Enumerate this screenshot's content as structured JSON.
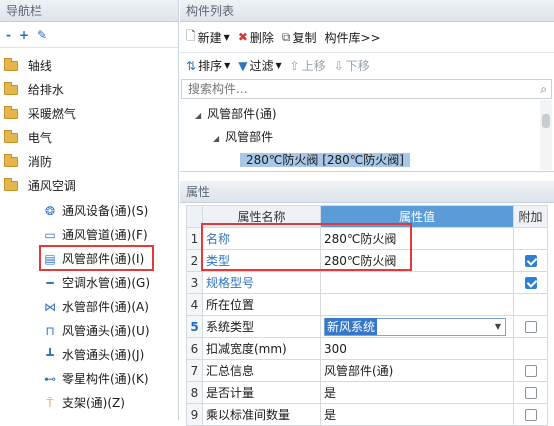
{
  "nav": {
    "title": "导航栏",
    "toolbar": {
      "collapse": "-",
      "expand": "+",
      "edit": "✎"
    },
    "items": [
      {
        "label": "轴线"
      },
      {
        "label": "给排水"
      },
      {
        "label": "采暖燃气"
      },
      {
        "label": "电气"
      },
      {
        "label": "消防"
      },
      {
        "label": "通风空调"
      }
    ],
    "sub_items": [
      {
        "label": "通风设备(通)(S)",
        "icon": "fan-icon"
      },
      {
        "label": "通风管道(通)(F)",
        "icon": "duct-icon"
      },
      {
        "label": "风管部件(通)(I)",
        "icon": "damper-icon",
        "selected": true
      },
      {
        "label": "空调水管(通)(G)",
        "icon": "pipe-icon"
      },
      {
        "label": "水管部件(通)(A)",
        "icon": "valve-icon"
      },
      {
        "label": "风管通头(通)(U)",
        "icon": "duct-fitting-icon"
      },
      {
        "label": "水管通头(通)(J)",
        "icon": "pipe-fitting-icon"
      },
      {
        "label": "零星构件(通)(K)",
        "icon": "misc-part-icon"
      },
      {
        "label": "支架(通)(Z)",
        "icon": "support-icon"
      }
    ]
  },
  "component_list": {
    "title": "构件列表",
    "toolbar1": {
      "new": "新建",
      "delete": "删除",
      "copy": "复制",
      "library": "构件库>>"
    },
    "toolbar2": {
      "sort": "排序",
      "filter": "过滤",
      "up": "上移",
      "down": "下移"
    },
    "search_placeholder": "搜索构件...",
    "tree": {
      "root": "风管部件(通)",
      "child": "风管部件",
      "leaf": "280℃防火阀 [280℃防火阀]"
    }
  },
  "properties": {
    "title": "属性",
    "headers": {
      "name": "属性名称",
      "value": "属性值",
      "add": "附加"
    },
    "rows": [
      {
        "idx": "1",
        "name": "名称",
        "value": "280℃防火阀"
      },
      {
        "idx": "2",
        "name": "类型",
        "value": "280℃防火阀"
      },
      {
        "idx": "3",
        "name": "规格型号",
        "value": ""
      },
      {
        "idx": "4",
        "name": "所在位置",
        "value": ""
      },
      {
        "idx": "5",
        "name": "系统类型",
        "value": "新风系统"
      },
      {
        "idx": "6",
        "name": "扣减宽度(mm)",
        "value": "300"
      },
      {
        "idx": "7",
        "name": "汇总信息",
        "value": "风管部件(通)"
      },
      {
        "idx": "8",
        "name": "是否计量",
        "value": "是"
      },
      {
        "idx": "9",
        "name": "乘以标准间数量",
        "value": "是"
      }
    ]
  },
  "colors": {
    "accent": "#2f80d1",
    "highlight_red": "#e23a3a",
    "header_blue": "#5b9bd8"
  }
}
